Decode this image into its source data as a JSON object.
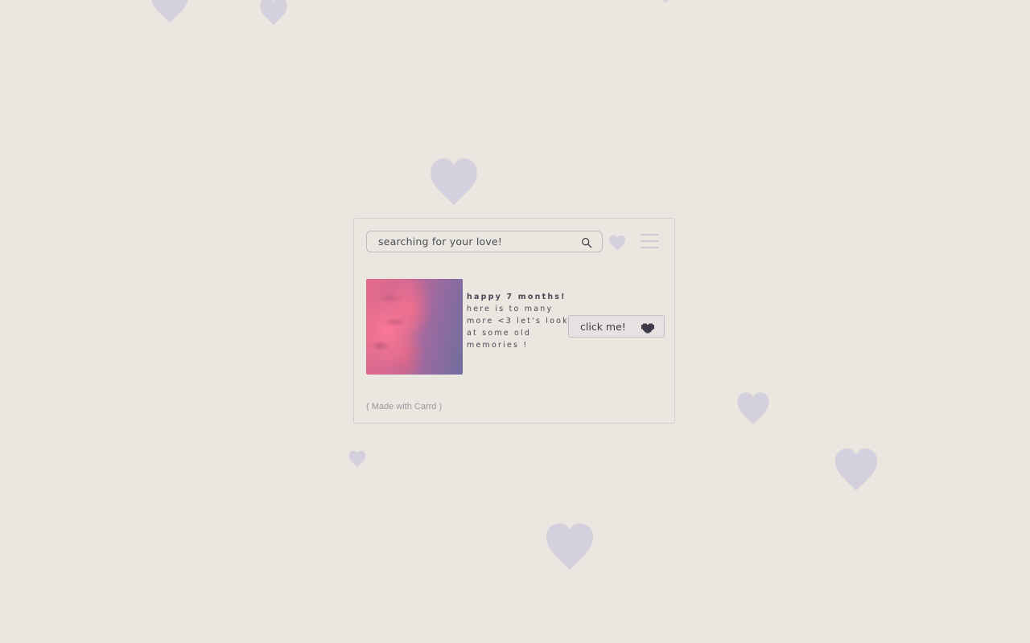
{
  "theme": {
    "heart_color": "#d5d0dd",
    "accent": "#3e3a48"
  },
  "search": {
    "value": "searching for your love!",
    "icon": "search-icon"
  },
  "header": {
    "favorite_icon": "heart-icon",
    "menu_icon": "hamburger-menu-icon"
  },
  "content": {
    "title": "happy 7 months!",
    "body": "here is to many more <3 let's look at some old memories !",
    "button_label": "click me!",
    "button_icon": "pixel-heart-icon"
  },
  "footer": {
    "credit": "( Made with Carrd )"
  }
}
